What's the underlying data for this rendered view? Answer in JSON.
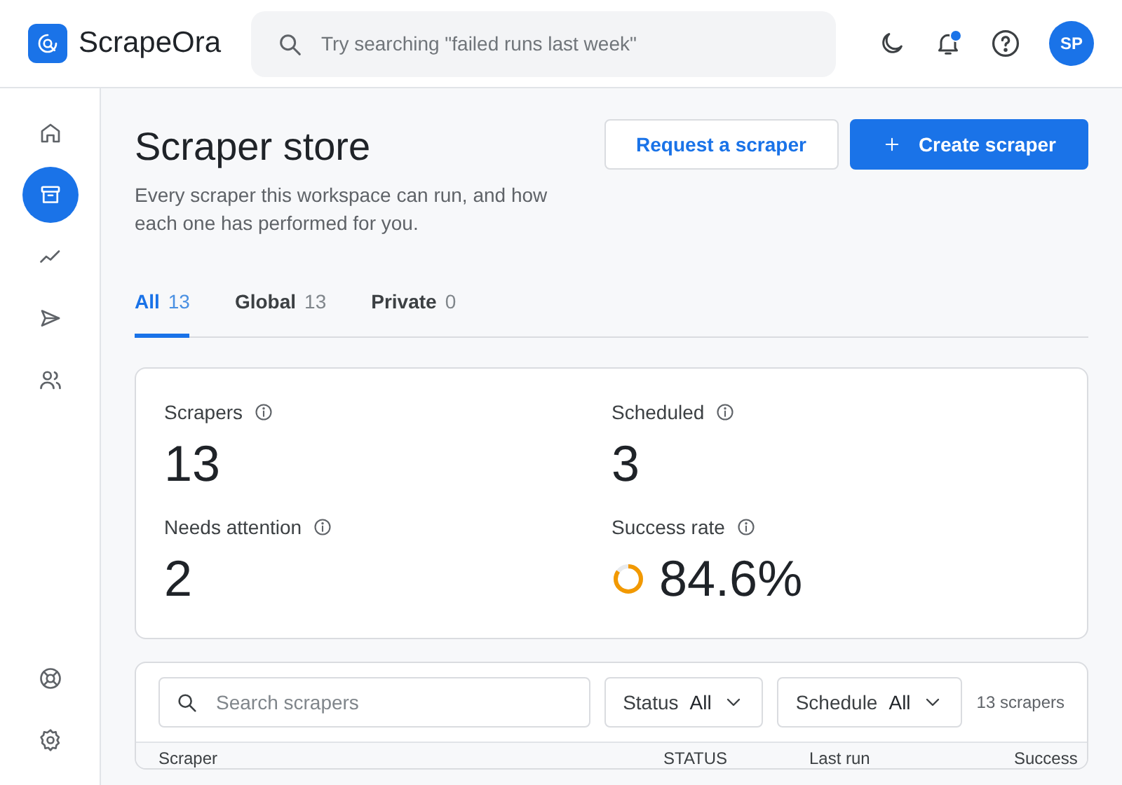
{
  "brand": {
    "name": "ScrapeOra"
  },
  "search": {
    "placeholder": "Try searching \"failed runs last week\""
  },
  "topbar": {
    "notification_badge": true,
    "avatar": "SP"
  },
  "sidebar": {
    "items": [
      {
        "selected": false
      },
      {
        "selected": true
      },
      {
        "selected": false
      },
      {
        "selected": false
      },
      {
        "selected": false
      }
    ],
    "footer_items": [
      {
        "selected": false
      },
      {
        "selected": false
      }
    ]
  },
  "page": {
    "title": "Scraper store",
    "subtitle": "Every scraper this workspace can run, and how each one has performed for you."
  },
  "actions": [
    {
      "label": "Request a scraper",
      "kind": "secondary"
    },
    {
      "label": "Create scraper",
      "kind": "primary"
    }
  ],
  "tabs": [
    {
      "label": "All",
      "count": "13",
      "selected": true
    },
    {
      "label": "Global",
      "count": "13",
      "selected": false
    },
    {
      "label": "Private",
      "count": "0",
      "selected": false
    }
  ],
  "stats": [
    {
      "label": "Scrapers",
      "value": "13"
    },
    {
      "label": "Scheduled",
      "value": "3"
    },
    {
      "label": "Needs attention",
      "value": "2"
    },
    {
      "label": "Success rate",
      "value": "84.6%",
      "level": 0.846
    }
  ],
  "filters": {
    "search_placeholder": "Search scrapers",
    "dropdowns": [
      {
        "label": "Status",
        "value": "All"
      },
      {
        "label": "Schedule",
        "value": "All"
      }
    ],
    "count": "13 scrapers"
  },
  "table": {
    "columns": [
      "Scraper",
      "STATUS",
      "Last run",
      "Success"
    ]
  }
}
